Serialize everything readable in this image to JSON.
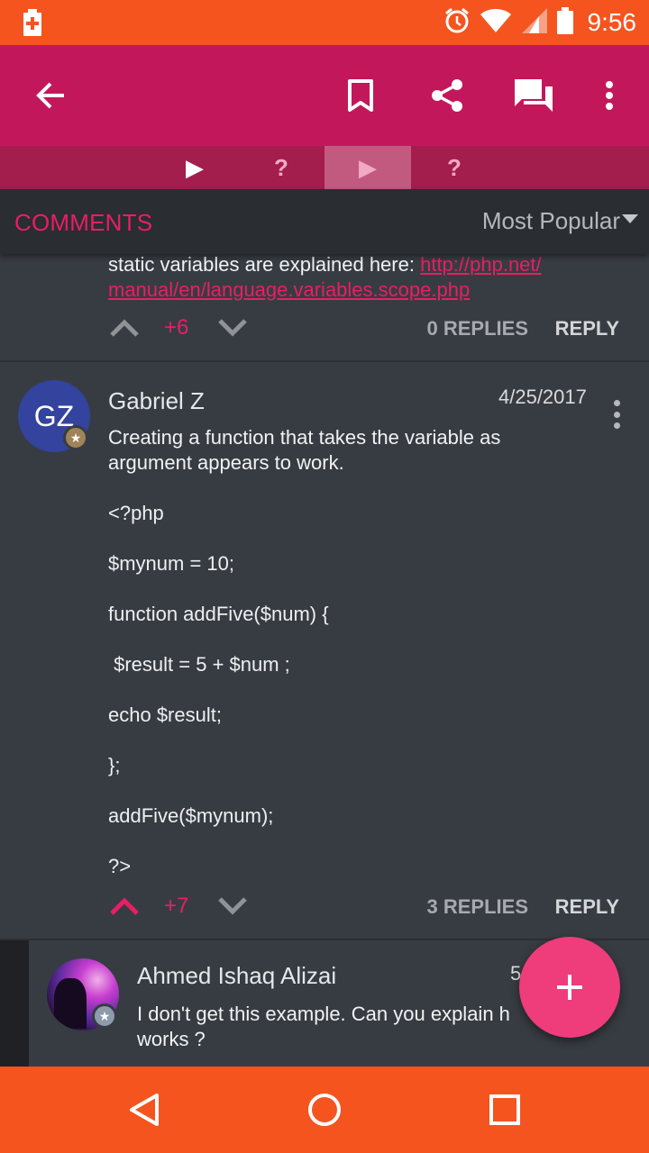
{
  "status_bar": {
    "time": "9:56",
    "icons": [
      "battery-saver-icon",
      "alarm-icon",
      "wifi-icon",
      "signal-icon",
      "battery-icon"
    ],
    "color": "#f5541f"
  },
  "toolbar": {
    "icons": [
      "back-arrow-icon",
      "bookmark-icon",
      "share-icon",
      "chat-icon",
      "overflow-menu-icon"
    ],
    "color": "#c2185b"
  },
  "nav_strip": {
    "items": [
      "▶",
      "?",
      "▶",
      "?"
    ],
    "selected_index": 2
  },
  "comments_header": {
    "title": "COMMENTS",
    "sort": "Most Popular"
  },
  "comments": [
    {
      "text_prefix": "static variables are explained here: ",
      "link_line1": "http://php.net/",
      "link_line2": "manual/en/language.variables.scope.php",
      "votes": "+6",
      "replies": "0 REPLIES",
      "reply": "REPLY"
    },
    {
      "avatar_initials": "GZ",
      "author": "Gabriel Z",
      "date": "4/25/2017",
      "text_line1": "Creating a function that takes the variable as",
      "text_line2": "argument appears to work.",
      "code_lines": [
        "<?php",
        "$mynum = 10;",
        "function addFive($num) {",
        " $result = 5 + $num ;",
        "echo $result;",
        "};",
        "addFive($mynum);",
        "?>"
      ],
      "votes": "+7",
      "replies": "3 REPLIES",
      "reply": "REPLY"
    }
  ],
  "reply_preview": {
    "author": "Ahmed Ishaq Alizai",
    "date": "5",
    "text_line1": "I don't get this example. Can you explain h",
    "text_line2": "works ?"
  },
  "fab": {
    "label": "+"
  },
  "accent": "#e91e63",
  "nav_bar": {
    "icons": [
      "back-triangle-icon",
      "home-circle-icon",
      "recents-square-icon"
    ]
  }
}
